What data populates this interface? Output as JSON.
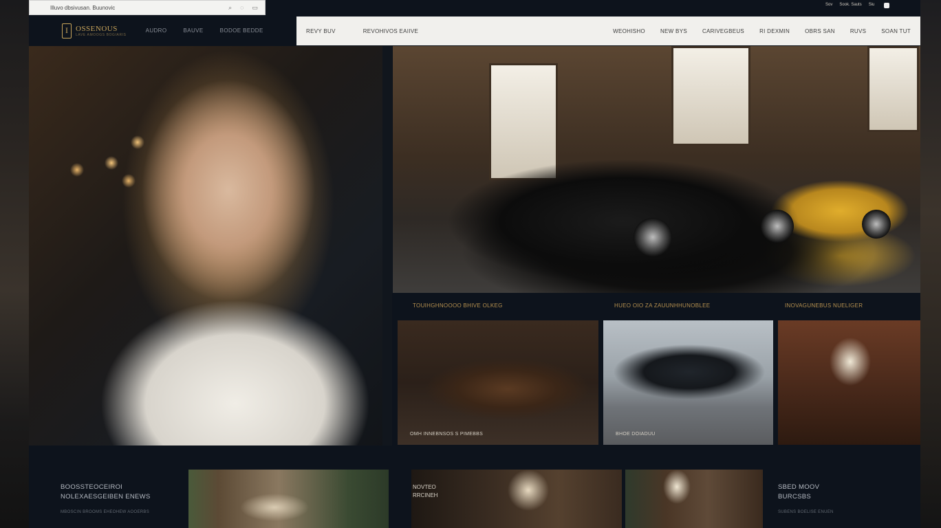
{
  "browser": {
    "title": "Illuvo dbsivusan. Buunovic",
    "icons": [
      "search-icon",
      "user-icon",
      "cart-icon"
    ]
  },
  "meta_right": {
    "items": [
      "Sov",
      "Sook. Sauts",
      "Siu"
    ]
  },
  "logo": {
    "name": "OSSENOUS",
    "tagline": "LAVE AMOOGS BOGIARIS"
  },
  "left_nav": {
    "items": [
      "AUDRO",
      "BAUVE",
      "BODOE BEDDE"
    ]
  },
  "top_nav": {
    "left": [
      "REVY BUV",
      "REVOHIVOS EAIIVE"
    ],
    "right": [
      "WEOHISHO",
      "NEW BYS",
      "CARIVEGBEUS",
      "RI DEXMIN",
      "OBRS SAN",
      "RUVS",
      "SOAN TUT"
    ]
  },
  "gallery": {
    "labels": [
      "TOUIHGHNOOOO BHIVE OLKEG",
      "HUEO OIO ZA ZAUUNHHUNOBLEE",
      "INOVAGUNEBUS NUELIGER"
    ],
    "cards": [
      {
        "caption": "OMH INNEBNSOS S PIMEBBS"
      },
      {
        "caption": "BHOE DOIADUU"
      },
      {
        "caption": ""
      }
    ]
  },
  "bottom": {
    "left_title_1": "BOOSSTEOCEIROI",
    "left_title_2": "NOLEXAESGEIBEN ENEWS",
    "left_sub": "MBOSCIN BROOMS EHEOHEW AOOERBS",
    "mini_1": "NOVTEO",
    "mini_2": "RRCINEH",
    "right_title_1": "SBED MOOV",
    "right_title_2": "BURCSBS",
    "right_sub": "SUBENS BOELISE ENUEN"
  },
  "colors": {
    "accent_gold": "#c8a45a",
    "page_bg": "#0d131c",
    "nav_bg": "#f1f0ed"
  }
}
